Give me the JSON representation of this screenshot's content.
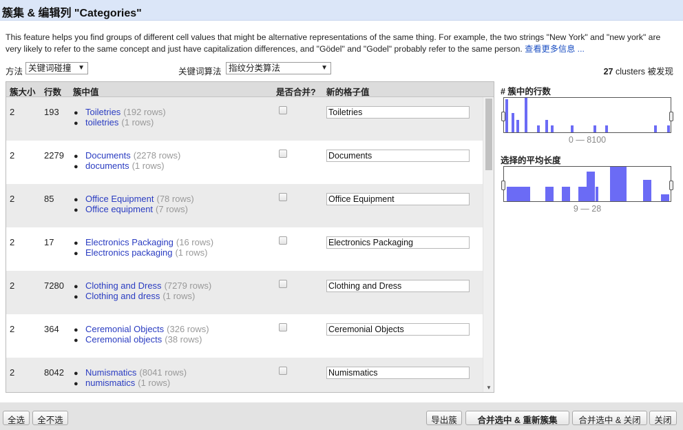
{
  "title": "簇集 & 编辑列 \"Categories\"",
  "description": "This feature helps you find groups of different cell values that might be alternative representations of the same thing. For example, the two strings \"New York\" and \"new york\" are very likely to refer to the same concept and just have capitalization differences, and \"Gödel\" and \"Godel\" probably refer to the same person.",
  "learn_more_link": "查看更多信息 ...",
  "controls": {
    "method_label": "方法",
    "method_value": "关键词碰撞",
    "keying_label": "关键词算法",
    "keying_value": "指纹分类算法",
    "clusters_count": "27",
    "clusters_suffix": "clusters 被发现"
  },
  "table": {
    "headers": [
      "簇大小",
      "行数",
      "簇中值",
      "是否合并?",
      "新的格子值"
    ],
    "rows": [
      {
        "size": "2",
        "count": "193",
        "values": [
          {
            "v": "Toiletries",
            "r": "(192 rows)"
          },
          {
            "v": "toiletries",
            "r": "(1 rows)"
          }
        ],
        "new_value": "Toiletries"
      },
      {
        "size": "2",
        "count": "2279",
        "values": [
          {
            "v": "Documents",
            "r": "(2278 rows)"
          },
          {
            "v": "documents",
            "r": "(1 rows)"
          }
        ],
        "new_value": "Documents"
      },
      {
        "size": "2",
        "count": "85",
        "values": [
          {
            "v": "Office Equipment",
            "r": "(78 rows)"
          },
          {
            "v": "Office equipment",
            "r": "(7 rows)"
          }
        ],
        "new_value": "Office Equipment"
      },
      {
        "size": "2",
        "count": "17",
        "values": [
          {
            "v": "Electronics Packaging",
            "r": "(16 rows)"
          },
          {
            "v": "Electronics packaging",
            "r": "(1 rows)"
          }
        ],
        "new_value": "Electronics Packaging"
      },
      {
        "size": "2",
        "count": "7280",
        "values": [
          {
            "v": "Clothing and Dress",
            "r": "(7279 rows)"
          },
          {
            "v": "Clothing and dress",
            "r": "(1 rows)"
          }
        ],
        "new_value": "Clothing and Dress"
      },
      {
        "size": "2",
        "count": "364",
        "values": [
          {
            "v": "Ceremonial Objects",
            "r": "(326 rows)"
          },
          {
            "v": "Ceremonial objects",
            "r": "(38 rows)"
          }
        ],
        "new_value": "Ceremonial Objects"
      },
      {
        "size": "2",
        "count": "8042",
        "values": [
          {
            "v": "Numismatics",
            "r": "(8041 rows)"
          },
          {
            "v": "numismatics",
            "r": "(1 rows)"
          }
        ],
        "new_value": "Numismatics"
      }
    ]
  },
  "facets": [
    {
      "title": "# 簇中的行数",
      "range": "0 — 8100",
      "bar_color": "#6b6bf5",
      "bars": [
        0.95,
        0.55,
        0.35,
        1.0,
        0.2,
        0.35,
        0.2,
        0.2,
        0.2,
        0.2,
        0.2,
        0.2,
        0.2
      ]
    },
    {
      "title": "选择的平均长度",
      "range": "9 — 28",
      "bar_color": "#6b6bf5",
      "bars": [
        0.42,
        0.42,
        0.42,
        0.42,
        0.85,
        0.42,
        1.0,
        0.62,
        0.2,
        0.2
      ]
    }
  ],
  "footer": {
    "select_all": "全选",
    "unselect_all": "全不选",
    "export": "导出簇",
    "merge_recluster": "合并选中 & 重新簇集",
    "merge_close": "合并选中 & 关闭",
    "close": "关闭"
  }
}
